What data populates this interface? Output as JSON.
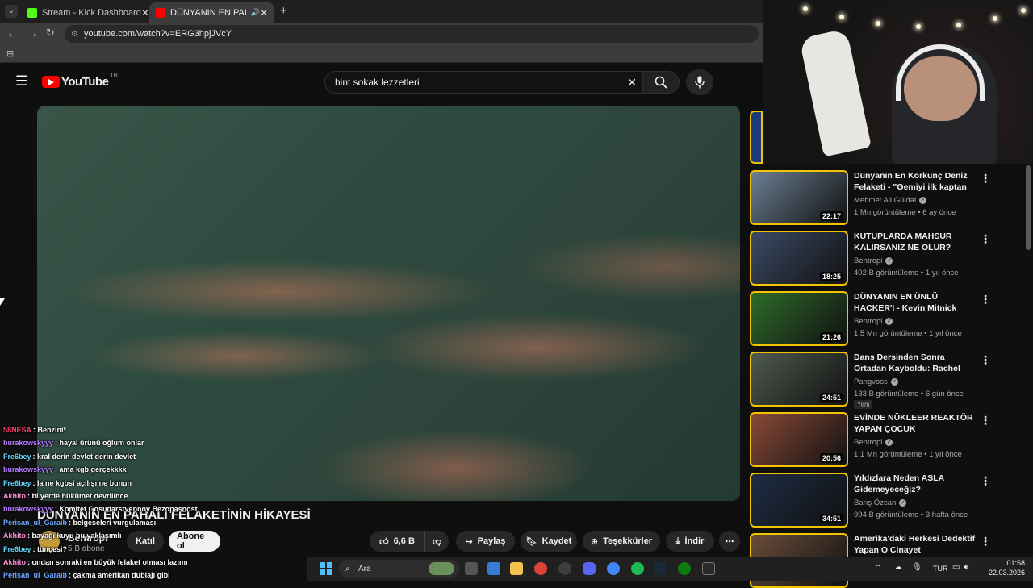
{
  "browser": {
    "tabs": [
      {
        "label": "Stream - Kick Dashboard",
        "color": "#53fc18"
      },
      {
        "label": "DÜNYANIN EN PAHALI FELA",
        "color": "#ff0000"
      }
    ],
    "url": "youtube.com/watch?v=ERG3hpjJVcY"
  },
  "youtube": {
    "logo_text": "YouTube",
    "region": "TR",
    "search_value": "hint sokak lezzetleri"
  },
  "video": {
    "title": "DÜNYANIN EN PAHALI FELAKETİNİN HİKAYESİ",
    "channel": "Bentropi",
    "subscribers": "5 B abone",
    "join_label": "Katıl",
    "subscribe_label": "Abone ol",
    "likes": "6,6 B",
    "share_label": "Paylaş",
    "save_label": "Kaydet",
    "thanks_label": "Teşekkürler",
    "download_label": "İndir"
  },
  "chat": [
    {
      "user": "58NESA",
      "color": "#ff3f6f",
      "msg": ": Benzini*"
    },
    {
      "user": "burakowskyyy",
      "color": "#b97cff",
      "msg": ": hayal ürünü oğlum onlar"
    },
    {
      "user": "Fre6bey",
      "color": "#5fd7ff",
      "msg": ": kral derin devlet derin devlet"
    },
    {
      "user": "burakowskyyy",
      "color": "#b97cff",
      "msg": ": ama kgb gerçekkkk"
    },
    {
      "user": "Fre6bey",
      "color": "#5fd7ff",
      "msg": ": la ne kgbsi açılışı ne bunun"
    },
    {
      "user": "Akhito",
      "color": "#ff8fd8",
      "msg": ": bi yerde hükümet devrilince"
    },
    {
      "user": "burakowskyyy",
      "color": "#b97cff",
      "msg": ": Komitet Gosudarstvennoy Bezopasnost"
    },
    {
      "user": "Perisan_ul_Garaib",
      "color": "#6fa8ff",
      "msg": ": belgeseleri vurgulaması"
    },
    {
      "user": "Akhito",
      "color": "#ff8fd8",
      "msg": ": bayağı kuyu bu yaklaşımlı"
    },
    {
      "user": "Fre6bey",
      "color": "#5fd7ff",
      "msg": ": tünçesi?"
    },
    {
      "user": "Akhito",
      "color": "#ff8fd8",
      "msg": ": ondan sonraki en büyük felaket olması lazımı"
    },
    {
      "user": "Perisan_ul_Garaib",
      "color": "#6fa8ff",
      "msg": ": çakma amerikan dublajı gibi"
    }
  ],
  "recommendations": [
    {
      "title": "Dünyanın En Korkunç Deniz Felaketi - \"Gemiyi ilk kaptan te...",
      "channel": "Mehmet Ali Güldal",
      "meta": "1 Mn görüntüleme • 6 ay önce",
      "duration": "22:17",
      "thumb": "#6b7f93",
      "new": ""
    },
    {
      "title": "KUTUPLARDA MAHSUR KALIRSANIZ NE OLUR?",
      "channel": "Bentropi",
      "meta": "402 B görüntüleme • 1 yıl önce",
      "duration": "18:25",
      "thumb": "#3c4a66",
      "new": ""
    },
    {
      "title": "DÜNYANIN EN ÜNLÜ HACKER'I - Kevin Mitnick",
      "channel": "Bentropi",
      "meta": "1,5 Mn görüntüleme • 1 yıl önce",
      "duration": "21:26",
      "thumb": "#2e6b2a",
      "new": ""
    },
    {
      "title": "Dans Dersinden Sonra Ortadan Kayboldu: Rachel Barber'a Ne ...",
      "channel": "Pangvoss",
      "meta": "133 B görüntüleme • 6 gün önce",
      "duration": "24:51",
      "thumb": "#4f5a4e",
      "new": "Yeni"
    },
    {
      "title": "EVİNDE NÜKLEER REAKTÖR YAPAN ÇOCUK",
      "channel": "Bentropi",
      "meta": "1,1 Mn görüntüleme • 1 yıl önce",
      "duration": "20:56",
      "thumb": "#8a4a38",
      "new": ""
    },
    {
      "title": "Yıldızlara Neden ASLA Gidemeyeceğiz?",
      "channel": "Barış Özcan",
      "meta": "994 B görüntüleme • 3 hafta önce",
      "duration": "34:51",
      "thumb": "#1e2c44",
      "new": ""
    },
    {
      "title": "Amerika'daki Herkesi Dedektif Yapan O Cinayet",
      "channel": "",
      "meta": "",
      "duration": "",
      "thumb": "#6a4d3a",
      "new": ""
    }
  ],
  "taskbar": {
    "search_placeholder": "Ara",
    "lang": "TUR",
    "time": "01:58",
    "date": "22.03.2026"
  }
}
